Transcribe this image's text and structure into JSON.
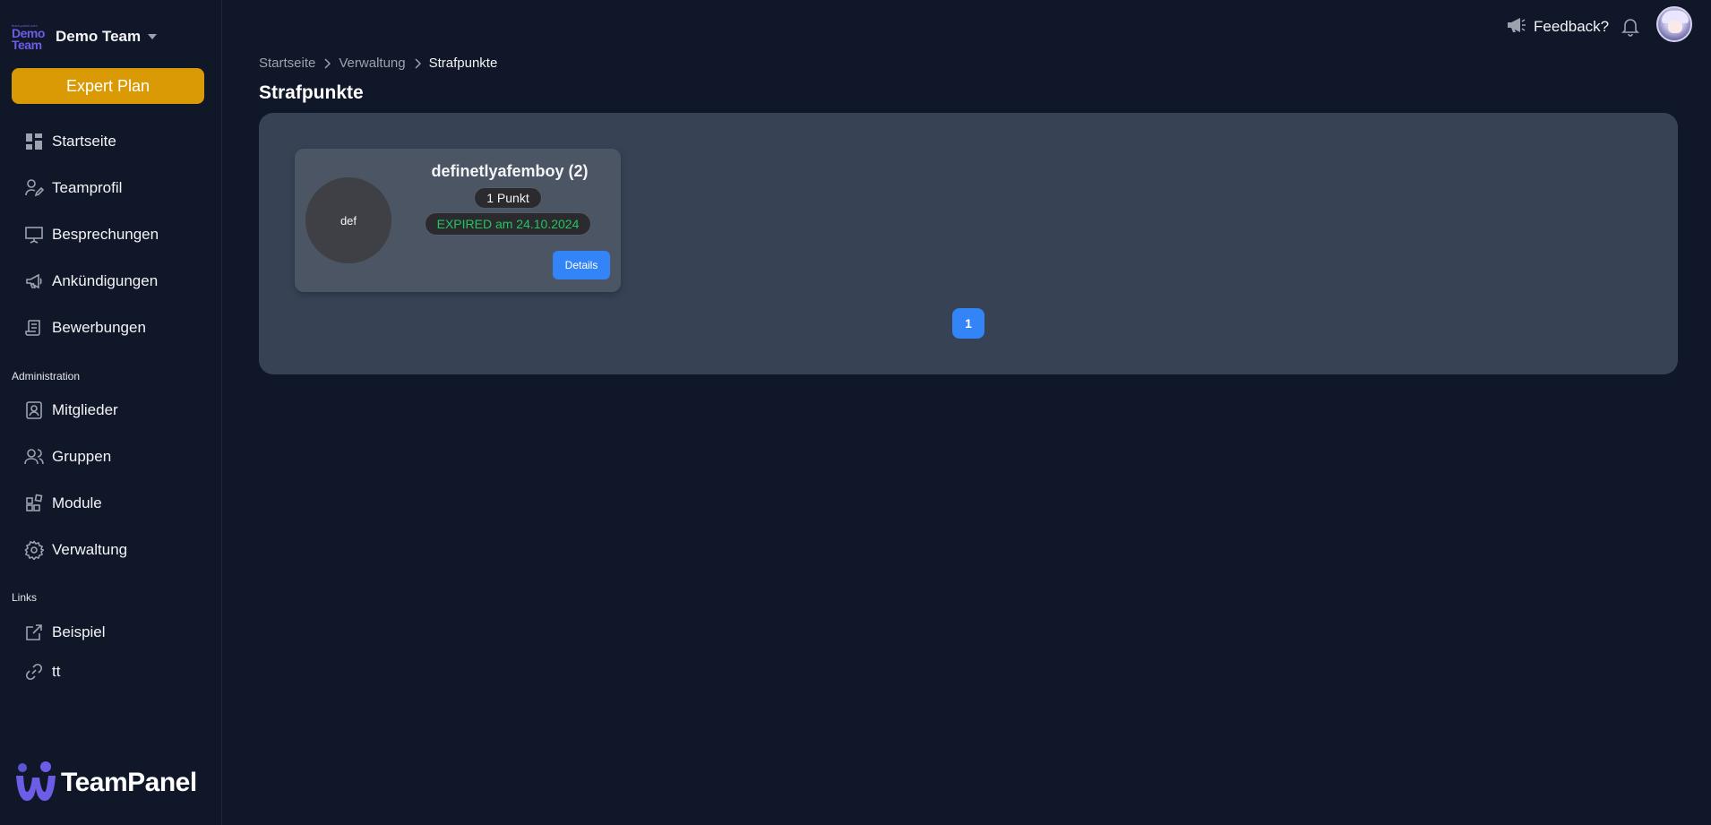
{
  "sidebar": {
    "team_logo": {
      "tiny": "team-panel.com",
      "line1": "Demo",
      "line2": "Team"
    },
    "team_name": "Demo Team",
    "plan_label": "Expert Plan",
    "items": [
      {
        "label": "Startseite",
        "icon": "dashboard-icon"
      },
      {
        "label": "Teamprofil",
        "icon": "user-pen-icon"
      },
      {
        "label": "Besprechungen",
        "icon": "presentation-icon"
      },
      {
        "label": "Ankündigungen",
        "icon": "megaphone-icon"
      },
      {
        "label": "Bewerbungen",
        "icon": "scroll-icon"
      }
    ],
    "admin_title": "Administration",
    "admin_items": [
      {
        "label": "Mitglieder",
        "icon": "member-card-icon"
      },
      {
        "label": "Gruppen",
        "icon": "users-icon"
      },
      {
        "label": "Module",
        "icon": "modules-icon"
      },
      {
        "label": "Verwaltung",
        "icon": "gear-icon"
      }
    ],
    "links_title": "Links",
    "link_items": [
      {
        "label": "Beispiel",
        "icon": "external-link-icon"
      },
      {
        "label": "tt",
        "icon": "link-icon"
      }
    ],
    "brand": "TeamPanel"
  },
  "topbar": {
    "feedback_label": "Feedback?"
  },
  "breadcrumb": [
    "Startseite",
    "Verwaltung",
    "Strafpunkte"
  ],
  "page_title": "Strafpunkte",
  "cards": [
    {
      "avatar_text": "def",
      "username": "definetlyafemboy (2)",
      "points": "1 Punkt",
      "status": "EXPIRED am 24.10.2024",
      "details_label": "Details"
    }
  ],
  "pagination": {
    "current": "1"
  },
  "colors": {
    "background": "#101728",
    "panel": "#374355",
    "card": "#4b5563",
    "accent": "#3384f6",
    "plan": "#d99a06",
    "expired": "#22c55e",
    "brand": "#6d5de6"
  }
}
